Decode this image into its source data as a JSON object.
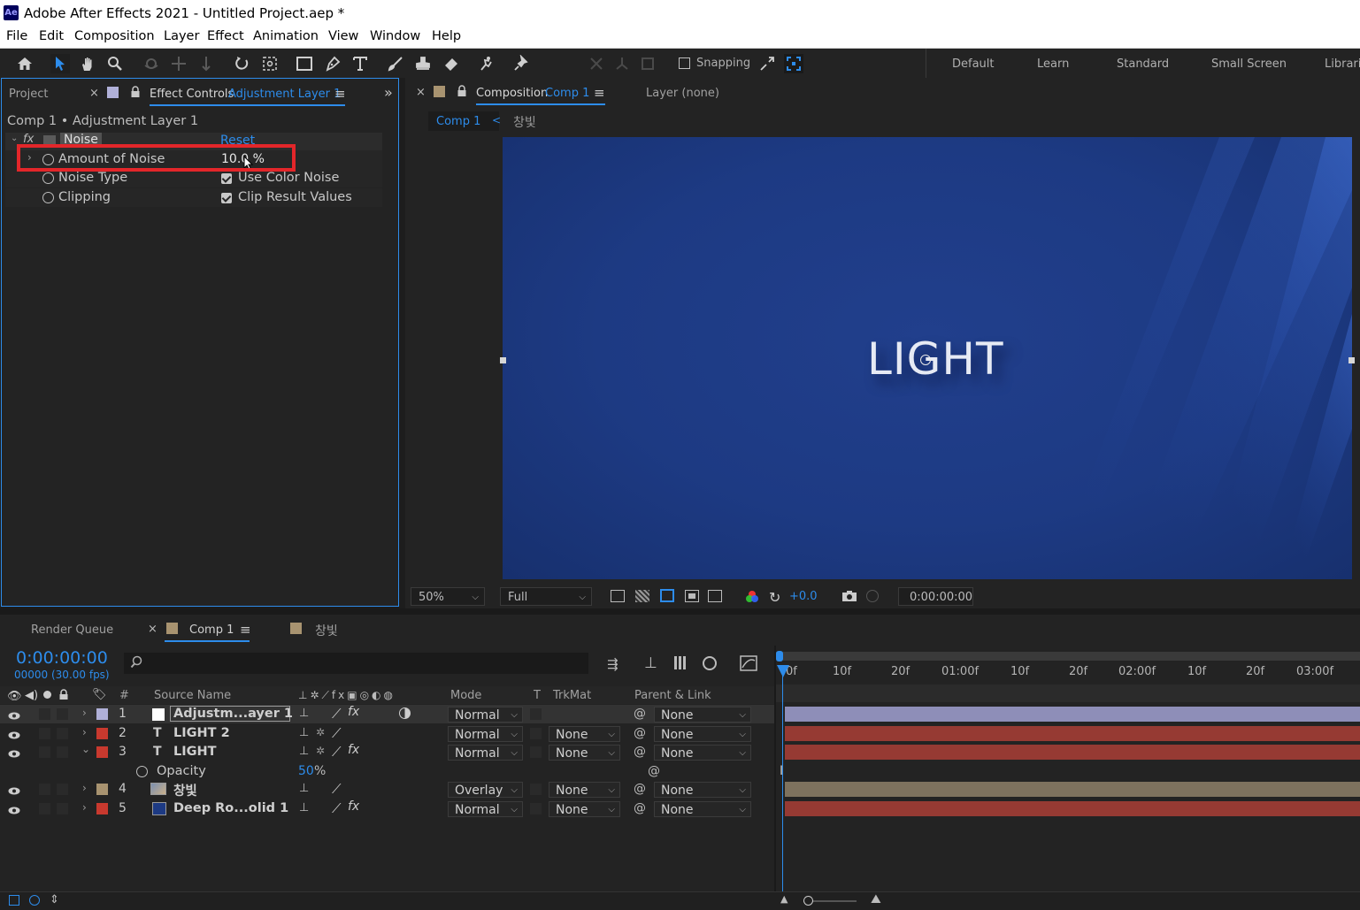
{
  "window": {
    "app_badge": "Ae",
    "title": "Adobe After Effects 2021 - Untitled Project.aep *"
  },
  "menu": [
    "File",
    "Edit",
    "Composition",
    "Layer",
    "Effect",
    "Animation",
    "View",
    "Window",
    "Help"
  ],
  "toolbar": {
    "snapping_label": "Snapping",
    "workspaces": [
      "Default",
      "Learn",
      "Standard",
      "Small Screen",
      "Librari"
    ]
  },
  "effect_panel": {
    "tab_project": "Project",
    "tab_close": "×",
    "tab_label": "Effect Controls",
    "tab_layer": "Adjustment Layer 1",
    "tab_menu": "≡",
    "more": "»",
    "breadcrumb": "Comp 1 • Adjustment Layer 1",
    "effect_fx": "fx",
    "effect_name": "Noise",
    "reset_label": "Reset",
    "properties": [
      {
        "label": "Amount of Noise",
        "value": "10.0 %"
      },
      {
        "label": "Noise Type",
        "value": "Use Color Noise"
      },
      {
        "label": "Clipping",
        "value": "Clip Result Values"
      }
    ]
  },
  "comp_panel": {
    "tab_close": "×",
    "tab_label": "Composition",
    "tab_comp": "Comp 1",
    "tab_menu": "≡",
    "layer_tab": "Layer (none)",
    "crumb_active": "Comp 1",
    "crumb_sep": "<",
    "crumb_other": "창빛",
    "canvas_text": "LIGHT",
    "footer": {
      "zoom": "50%",
      "resolution": "Full",
      "exposure": "+0.0",
      "timecode": "0:00:00:00"
    }
  },
  "timeline": {
    "tab_render": "Render Queue",
    "tab_close": "×",
    "tab_comp": "Comp 1",
    "tab_menu": "≡",
    "tab_other": "창빛",
    "current_time": "0:00:00:00",
    "frame_info": "00000 (30.00 fps)",
    "columns": {
      "num": "#",
      "source_name": "Source Name",
      "mode": "Mode",
      "t": "T",
      "trkmat": "TrkMat",
      "parent": "Parent & Link"
    },
    "ruler": [
      "0f",
      "10f",
      "20f",
      "01:00f",
      "10f",
      "20f",
      "02:00f",
      "10f",
      "20f",
      "03:00f"
    ],
    "layers": [
      {
        "num": "1",
        "type": "",
        "name": "Adjustm...ayer 1",
        "mode": "Normal",
        "trkmat": "",
        "parent": "None",
        "color": "#b0b0d8"
      },
      {
        "num": "2",
        "type": "T",
        "name": "LIGHT 2",
        "mode": "Normal",
        "trkmat": "None",
        "parent": "None",
        "color": "#c8392e"
      },
      {
        "num": "3",
        "type": "T",
        "name": "LIGHT",
        "mode": "Normal",
        "trkmat": "None",
        "parent": "None",
        "color": "#c8392e"
      },
      {
        "num": "4",
        "type": "",
        "name": "창빛",
        "mode": "Overlay",
        "trkmat": "None",
        "parent": "None",
        "color": "#a89370"
      },
      {
        "num": "5",
        "type": "",
        "name": "Deep Ro...olid 1",
        "mode": "Normal",
        "trkmat": "None",
        "parent": "None",
        "color": "#c8392e"
      }
    ],
    "opacity": {
      "label": "Opacity",
      "value": "50",
      "unit": "%"
    }
  },
  "colors": {
    "accent": "#2d8ceb",
    "highlight": "#e3262a",
    "canvas": "#1d3a83"
  }
}
